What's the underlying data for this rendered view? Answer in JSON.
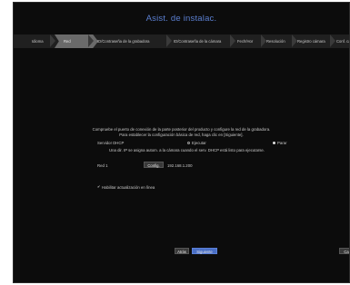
{
  "window": {
    "title": "Asist. de instalac."
  },
  "tabs": [
    {
      "label": "Idioma"
    },
    {
      "label": "Red"
    },
    {
      "label": "ID/Contraseña de la grabadora"
    },
    {
      "label": "ID/Contraseña de la cámara"
    },
    {
      "label": "Fech/Hor"
    },
    {
      "label": "Resolución"
    },
    {
      "label": "Registro cámara"
    },
    {
      "label": "Conf. ca"
    }
  ],
  "network": {
    "instruction_line1": "Compruebe el puerto de conexión de la parte posterior del producto y configure la red de la grabadora.",
    "instruction_line2": "Para establecer la configuración básica de red, haga clic en [Siguiente].",
    "dhcp_label": "Servidor DHCP",
    "dhcp_option_run": "Ejecutar",
    "dhcp_option_stop": "Parar",
    "dhcp_selected": "Parar",
    "dhcp_note": "Una dir. IP se asigna autom. a la cámara cuando el serv. DHCP está listo para ejecutarse.",
    "network1_label": "Red 1",
    "config_button": "Config.",
    "ip_address": "192.168.1.200",
    "online_update_checked": true,
    "online_update_label": "Habilitar actualización en línea"
  },
  "footer": {
    "back_button": "Atrás",
    "next_button": "Siguiente",
    "cancel_button": "Ca"
  }
}
